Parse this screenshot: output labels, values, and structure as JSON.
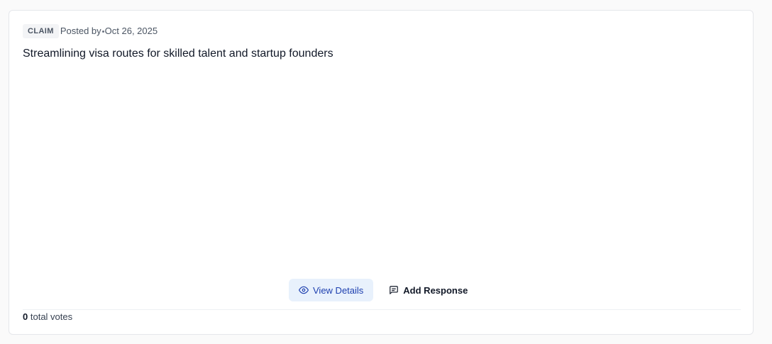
{
  "post": {
    "badge": "CLAIM",
    "posted_by": "Posted by",
    "date": "Oct 26, 2025",
    "title": "Streamlining visa routes for skilled talent and startup founders"
  },
  "actions": {
    "view_details_label": "View Details",
    "view_details_icon": "eye-icon",
    "add_response_label": "Add Response",
    "add_response_icon": "message-square-icon"
  },
  "votes": {
    "count": "0",
    "label": "total votes"
  },
  "colors": {
    "view_button_bg": "#e8f1fc",
    "view_button_text": "#1e40af",
    "badge_bg": "#f3f4f6"
  }
}
